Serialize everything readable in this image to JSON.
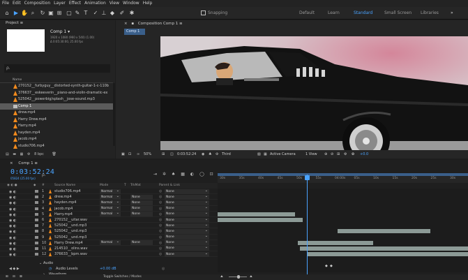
{
  "menu": [
    "File",
    "Edit",
    "Composition",
    "Layer",
    "Effect",
    "Animation",
    "View",
    "Window",
    "Help"
  ],
  "toolbar": {
    "snapping_label": "Snapping",
    "workspaces": [
      {
        "label": "Default",
        "active": false
      },
      {
        "label": "Learn",
        "active": false
      },
      {
        "label": "Standard",
        "active": true
      },
      {
        "label": "Small Screen",
        "active": false
      },
      {
        "label": "Libraries",
        "active": false
      }
    ],
    "more": "»"
  },
  "project": {
    "tab_label": "Project ≡",
    "comp_name": "Comp 1 ▾",
    "comp_meta1": "1920 x 1080 (960 x 540) (1.00)",
    "comp_meta2": "Δ 0:05:30:00, 25.00 fps",
    "search_placeholder": "ρ.",
    "name_header": "Name",
    "items": [
      {
        "label": "270152__furbyguy__distorted-synth-guitar-1-c-110b",
        "type": "audio"
      },
      {
        "label": "376637__eskeeverin__piano-and-violin-dramatic-ex",
        "type": "audio"
      },
      {
        "label": "525042__powerbig/splash__jose-sound.mp3",
        "type": "audio"
      },
      {
        "label": "Comp 1",
        "type": "comp",
        "selected": true
      },
      {
        "label": "drew.mp4",
        "type": "video"
      },
      {
        "label": "Harry Drew.mp4",
        "type": "video"
      },
      {
        "label": "Harry.mp4",
        "type": "video"
      },
      {
        "label": "hayden.mp4",
        "type": "video"
      },
      {
        "label": "jacob.mp4",
        "type": "video"
      },
      {
        "label": "studio706.mp4",
        "type": "video"
      }
    ],
    "footer": "8 bpc"
  },
  "viewer": {
    "tab_label": "Composition Comp 1 ≡",
    "comp_button": "Comp 1",
    "zoom": "50%",
    "timecode": "0:03:52:24",
    "quality": "Third",
    "camera": "Active Camera",
    "views": "1 View",
    "exposure": "+0.0"
  },
  "timeline": {
    "tab_label": "Comp 1 ≡",
    "timecode": "0:03:52:24",
    "timecode_sub": "05824 (25.00 fps)",
    "search_placeholder": "ρ.",
    "headers": {
      "source": "Source Name",
      "mode": "Mode",
      "t": "T",
      "trkmat": "TrkMat",
      "parent": "Parent & Link"
    },
    "layers": [
      {
        "num": "1",
        "name": "studio706.mp4",
        "mode": "Normal",
        "trkmat": "",
        "parent": "None"
      },
      {
        "num": "2",
        "name": "drew.mp4",
        "mode": "Normal",
        "trkmat": "None",
        "parent": "None"
      },
      {
        "num": "3",
        "name": "hayden.mp4",
        "mode": "Normal",
        "trkmat": "None",
        "parent": "None"
      },
      {
        "num": "4",
        "name": "jacob.mp4",
        "mode": "Normal",
        "trkmat": "None",
        "parent": "None"
      },
      {
        "num": "5",
        "name": "Harry.mp4",
        "mode": "Normal",
        "trkmat": "None",
        "parent": "None"
      },
      {
        "num": "6",
        "name": "270152__uitar.wav",
        "mode": "",
        "trkmat": "",
        "parent": "None"
      },
      {
        "num": "7",
        "name": "525042__und.mp3",
        "mode": "",
        "trkmat": "",
        "parent": "None"
      },
      {
        "num": "8",
        "name": "525042__und.mp3",
        "mode": "",
        "trkmat": "",
        "parent": "None"
      },
      {
        "num": "9",
        "name": "525042__und.mp3",
        "mode": "",
        "trkmat": "",
        "parent": "None"
      },
      {
        "num": "10",
        "name": "Harry Drew.mp4",
        "mode": "Normal",
        "trkmat": "None",
        "parent": "None"
      },
      {
        "num": "11",
        "name": "214510__olins.wav",
        "mode": "",
        "trkmat": "",
        "parent": "None"
      },
      {
        "num": "12",
        "name": "376633__bpm.wav",
        "mode": "",
        "trkmat": "",
        "parent": "None"
      }
    ],
    "audio_label": "Audio",
    "audio_levels_label": "Audio Levels",
    "audio_levels_value": "+0.00 dB",
    "waveform_label": "Waveform",
    "toggle_label": "Toggle Switches / Modes",
    "ruler": [
      "30s",
      "35s",
      "40s",
      "45s",
      "50s",
      "55s",
      "04:00s",
      "05s",
      "10s",
      "15s",
      "20s",
      "25s",
      "30s"
    ],
    "clips": [
      {
        "row": 4,
        "start": 0.0,
        "end": 0.31
      },
      {
        "row": 5,
        "start": 0.0,
        "end": 0.34
      },
      {
        "row": 7,
        "start": 0.48,
        "end": 0.85
      },
      {
        "row": 9,
        "start": 0.32,
        "end": 0.62
      },
      {
        "row": 10,
        "start": 0.33,
        "end": 1.0
      },
      {
        "row": 11,
        "start": 0.36,
        "end": 1.0
      }
    ]
  }
}
